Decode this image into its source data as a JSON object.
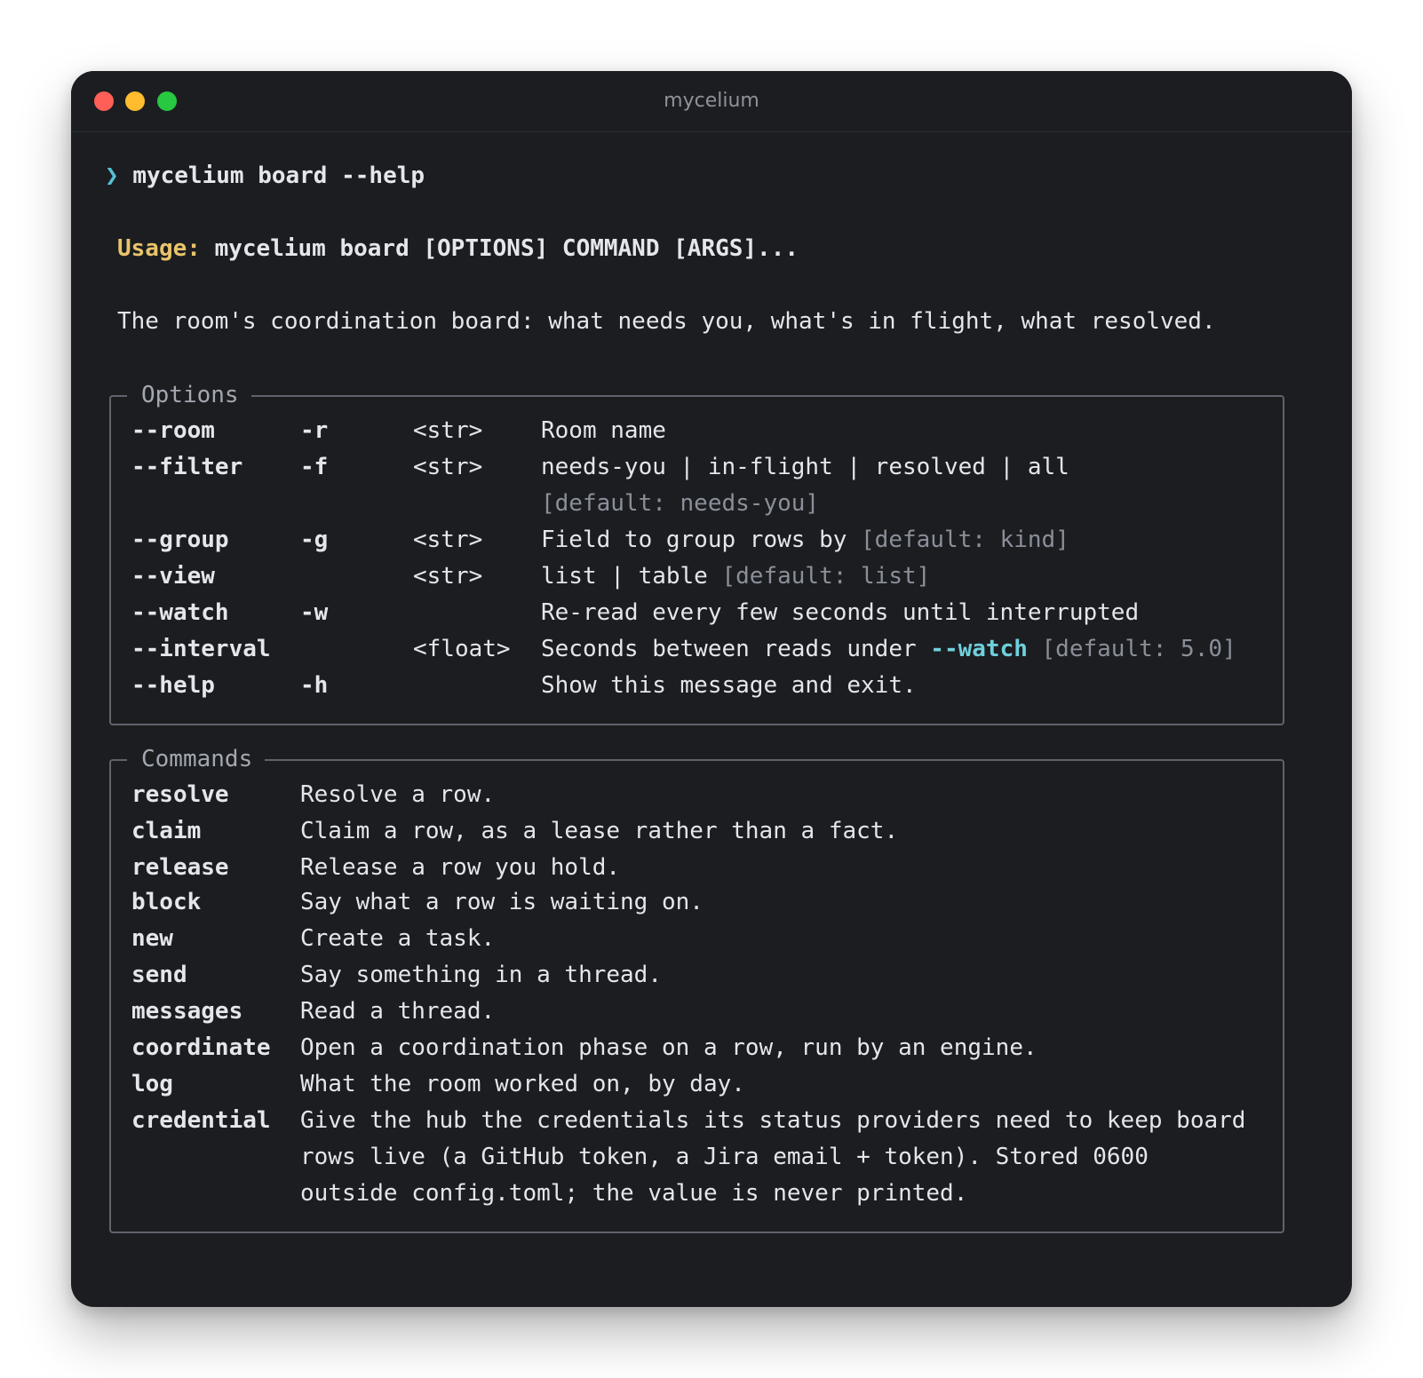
{
  "window": {
    "title": "mycelium"
  },
  "terminal": {
    "prompt_symbol": "❯",
    "command": "mycelium board --help",
    "usage_label": "Usage:",
    "usage_text": "mycelium board [OPTIONS] COMMAND [ARGS]...",
    "description": "The room's coordination board: what needs you, what's in flight, what resolved."
  },
  "options": {
    "title": "Options",
    "rows": [
      {
        "long": "--room",
        "short": "-r",
        "type": "<str>",
        "desc": "Room name",
        "default": ""
      },
      {
        "long": "--filter",
        "short": "-f",
        "type": "<str>",
        "desc": "needs-you | in-flight | resolved | all",
        "default": ""
      },
      {
        "long": "",
        "short": "",
        "type": "",
        "desc": "",
        "default": "[default: needs-you]"
      },
      {
        "long": "--group",
        "short": "-g",
        "type": "<str>",
        "desc": "Field to group rows by ",
        "default": "[default: kind]"
      },
      {
        "long": "--view",
        "short": "",
        "type": "<str>",
        "desc": "list | table ",
        "default": "[default: list]"
      },
      {
        "long": "--watch",
        "short": "-w",
        "type": "",
        "desc": "Re-read every few seconds until interrupted",
        "default": ""
      },
      {
        "long": "--interval",
        "short": "",
        "type": "<float>",
        "desc": "Seconds between reads under ",
        "ref": "--watch",
        "default": " [default: 5.0]"
      },
      {
        "long": "--help",
        "short": "-h",
        "type": "",
        "desc": "Show this message and exit.",
        "default": ""
      }
    ]
  },
  "commands": {
    "title": "Commands",
    "rows": [
      {
        "name": "resolve",
        "desc": "Resolve a row."
      },
      {
        "name": "claim",
        "desc": "Claim a row, as a lease rather than a fact."
      },
      {
        "name": "release",
        "desc": "Release a row you hold."
      },
      {
        "name": "block",
        "desc": "Say what a row is waiting on."
      },
      {
        "name": "new",
        "desc": "Create a task."
      },
      {
        "name": "send",
        "desc": "Say something in a thread."
      },
      {
        "name": "messages",
        "desc": "Read a thread."
      },
      {
        "name": "coordinate",
        "desc": "Open a coordination phase on a row, run by an engine."
      },
      {
        "name": "log",
        "desc": "What the room worked on, by day."
      },
      {
        "name": "credential",
        "desc": "Give the hub the credentials its status providers need to keep board"
      },
      {
        "name": "",
        "desc": "rows live (a GitHub token, a Jira email + token). Stored 0600"
      },
      {
        "name": "",
        "desc": "outside config.toml; the value is never printed."
      }
    ]
  }
}
